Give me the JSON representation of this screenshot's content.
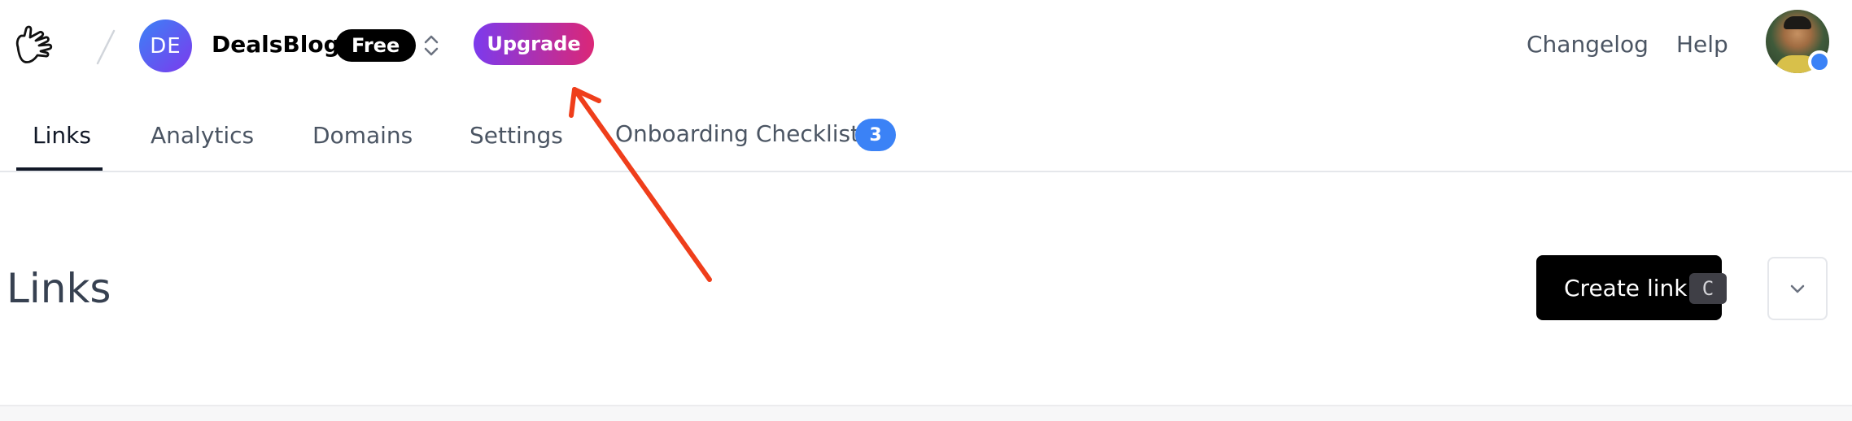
{
  "workspace": {
    "initials": "DE",
    "name": "DealsBlog",
    "plan": "Free"
  },
  "header": {
    "upgrade_label": "Upgrade",
    "links": [
      {
        "label": "Changelog"
      },
      {
        "label": "Help"
      }
    ]
  },
  "tabs": [
    {
      "label": "Links",
      "active": true
    },
    {
      "label": "Analytics"
    },
    {
      "label": "Domains"
    },
    {
      "label": "Settings"
    },
    {
      "label": "Onboarding Checklist",
      "badge": "3"
    }
  ],
  "main": {
    "title": "Links",
    "create_label": "Create link",
    "create_shortcut": "C"
  },
  "icons": {
    "logo": "hand-logo-icon",
    "workspace_switcher": "chevron-up-down-icon",
    "more": "chevron-down-icon"
  },
  "colors": {
    "upgrade_gradient_start": "#7c3aed",
    "upgrade_gradient_end": "#db2777",
    "badge_blue": "#3b82f6",
    "annotation_arrow": "#ef3e1b"
  }
}
